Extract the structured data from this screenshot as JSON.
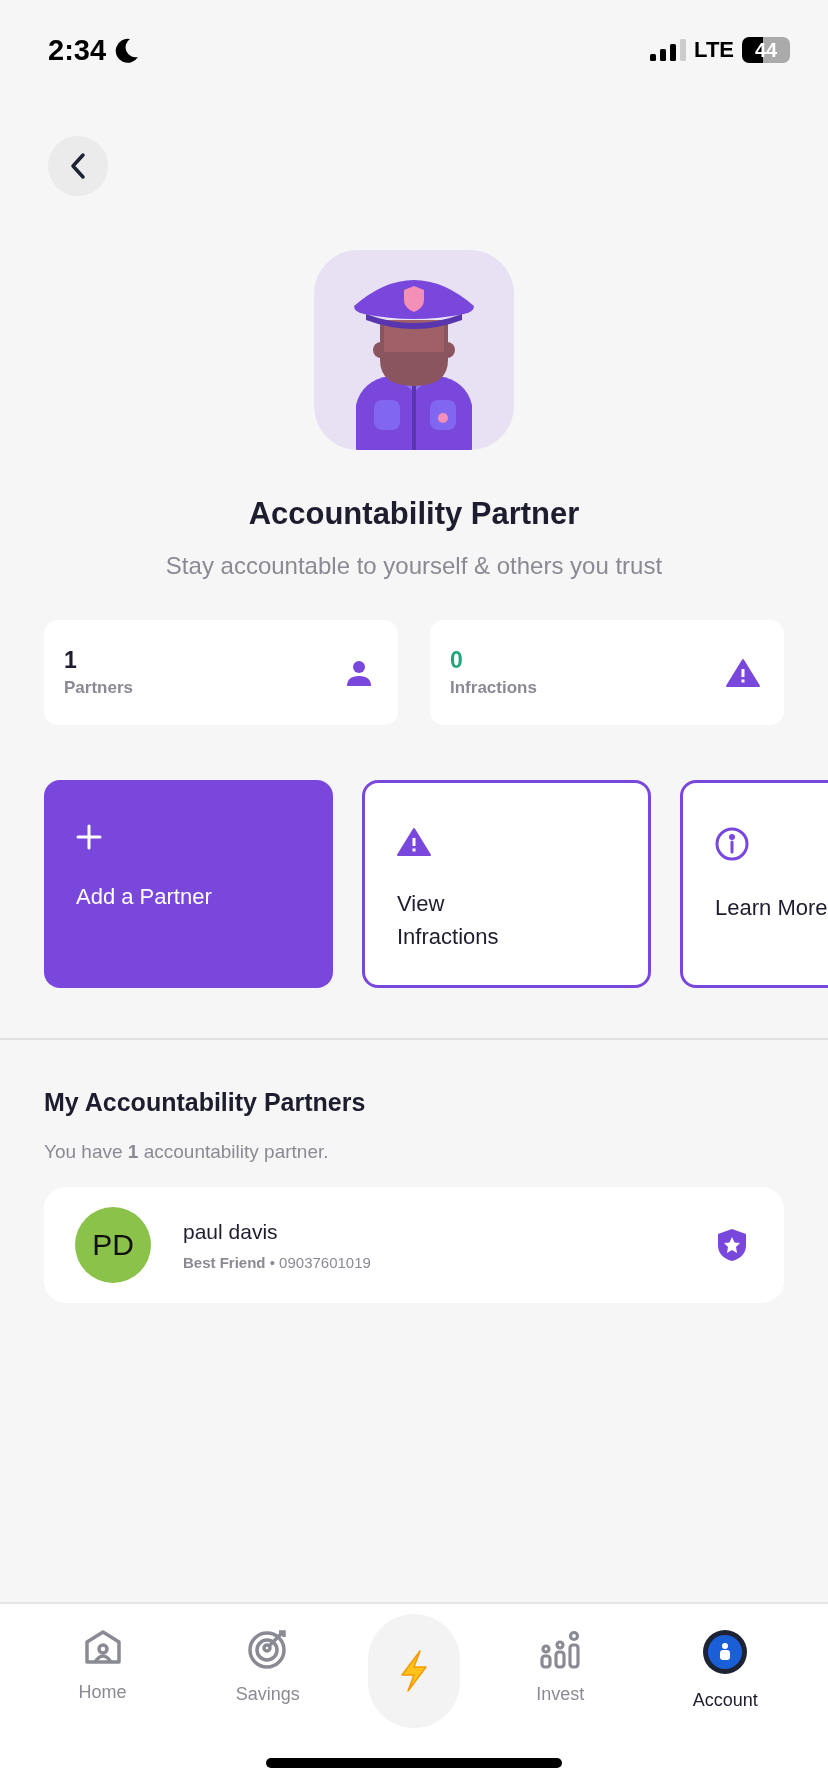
{
  "status_bar": {
    "time": "2:34",
    "network": "LTE",
    "battery": "44"
  },
  "header": {
    "title": "Accountability Partner",
    "subtitle": "Stay accountable to yourself & others you trust"
  },
  "stats": [
    {
      "value": "1",
      "label": "Partners",
      "color": "#1d1d2f",
      "kind": "person"
    },
    {
      "value": "0",
      "label": "Infractions",
      "color": "#1fa878",
      "kind": "warning"
    }
  ],
  "actions": [
    {
      "label": "Add a Partner",
      "kind": "filled"
    },
    {
      "label": "View Infractions",
      "kind": "outlined"
    },
    {
      "label": "Learn More",
      "kind": "outlined"
    }
  ],
  "partners_section": {
    "title": "My Accountability Partners",
    "summary": "You have **1** accountability partner.",
    "partners": [
      {
        "initials": "PD",
        "name": "paul davis",
        "detail": "**Best Friend** • 09037601019"
      }
    ]
  },
  "tab_bar": [
    {
      "kind": "home",
      "label": "Home",
      "selected": false
    },
    {
      "kind": "savings",
      "label": "Savings",
      "selected": false
    },
    {
      "kind": "boost",
      "selected": false
    },
    {
      "kind": "invest",
      "label": "Invest",
      "selected": false
    },
    {
      "kind": "account",
      "label": "Account",
      "selected": true
    }
  ]
}
